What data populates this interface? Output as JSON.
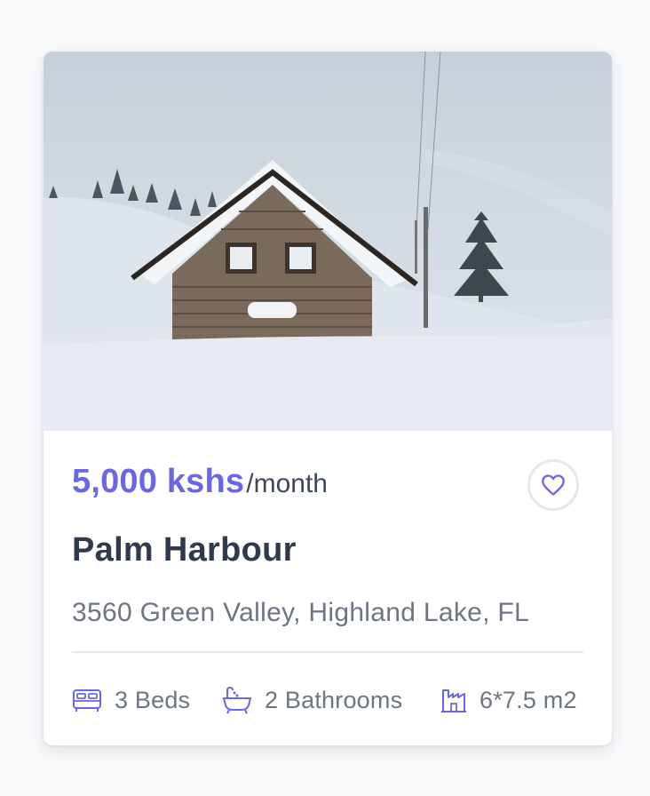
{
  "card": {
    "price": "5,000 kshs",
    "period": "/month",
    "title": "Palm Harbour",
    "address": "3560 Green Valley, Highland Lake, FL",
    "features": {
      "beds": "3 Beds",
      "baths": "2 Bathrooms",
      "area": "6*7.5 m2"
    },
    "icons": {
      "favorite": "heart-icon",
      "beds": "bed-icon",
      "baths": "bathtub-icon",
      "area": "building-icon"
    },
    "colors": {
      "accent": "#6b66e6",
      "title": "#2f3a4c",
      "muted": "#6d7583"
    }
  }
}
